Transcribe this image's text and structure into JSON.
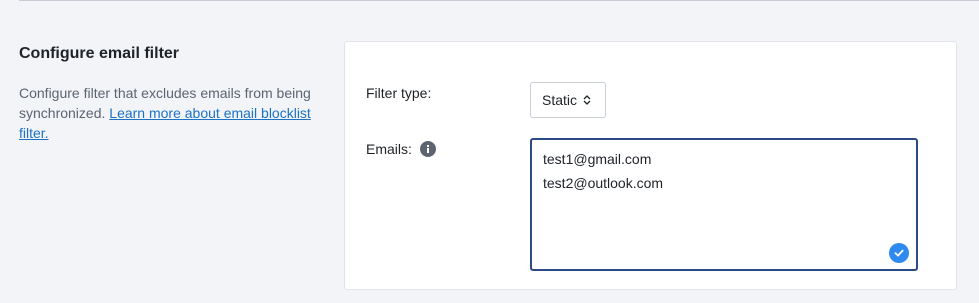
{
  "section": {
    "title": "Configure email filter",
    "description": "Configure filter that excludes emails from being synchronized.",
    "link_text": "Learn more about email blocklist filter."
  },
  "form": {
    "filter_type_label": "Filter type:",
    "filter_type_value": "Static",
    "emails_label": "Emails:",
    "emails": [
      "test1@gmail.com",
      "test2@outlook.com"
    ]
  },
  "icons": {
    "info": "info-icon",
    "select_chevron": "chevron-up-down-icon",
    "valid": "check-circle-icon"
  },
  "colors": {
    "link": "#1d72c5",
    "textarea_border": "#2b4a85",
    "check_badge": "#2f8af0",
    "page_background": "#f2f4f7"
  }
}
